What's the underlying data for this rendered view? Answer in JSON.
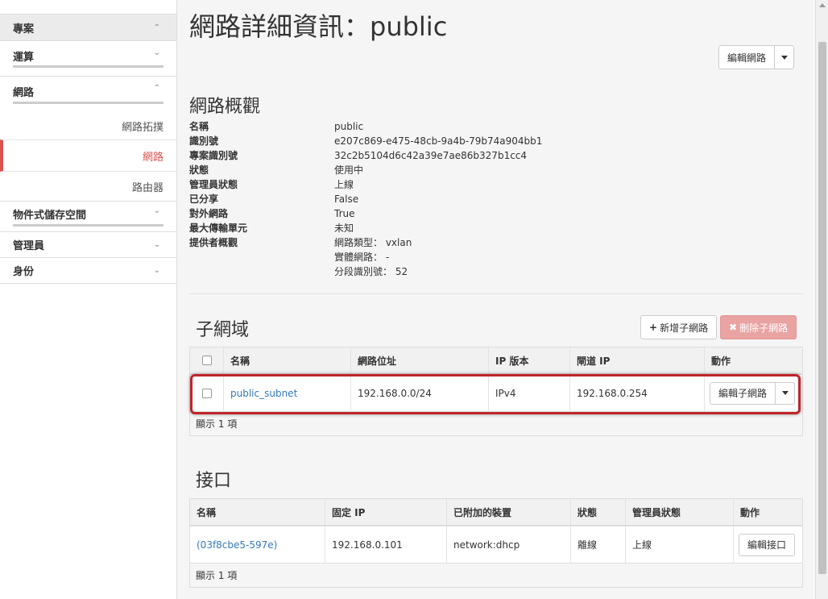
{
  "sidebar": {
    "project": "專案",
    "compute": "運算",
    "network": "網路",
    "network_items": [
      "網路拓撲",
      "網路",
      "路由器"
    ],
    "object_storage": "物件式儲存空間",
    "admin": "管理員",
    "identity": "身份"
  },
  "page": {
    "title": "網路詳細資訊：public",
    "edit_network": "編輯網路"
  },
  "overview": {
    "title": "網路概觀",
    "rows": [
      {
        "label": "名稱",
        "value": "public"
      },
      {
        "label": "識別號",
        "value": "e207c869-e475-48cb-9a4b-79b74a904bb1"
      },
      {
        "label": "專案識別號",
        "value": "32c2b5104d6c42a39e7ae86b327b1cc4"
      },
      {
        "label": "狀態",
        "value": "使用中"
      },
      {
        "label": "管理員狀態",
        "value": "上線"
      },
      {
        "label": "已分享",
        "value": "False"
      },
      {
        "label": "對外網路",
        "value": "True"
      },
      {
        "label": "最大傳輸單元",
        "value": "未知"
      },
      {
        "label": "提供者概觀",
        "value": "網路類型： vxlan"
      },
      {
        "label": "",
        "value": "實體網路： -"
      },
      {
        "label": "",
        "value": "分段識別號： 52"
      }
    ]
  },
  "subnets": {
    "title": "子網域",
    "add_button": "新增子網路",
    "delete_button": "刪除子網路",
    "headers": [
      "名稱",
      "網路位址",
      "IP 版本",
      "閘道 IP",
      "動作"
    ],
    "row": {
      "name": "public_subnet",
      "cidr": "192.168.0.0/24",
      "ip_version": "IPv4",
      "gateway": "192.168.0.254",
      "action": "編輯子網路"
    },
    "footer": "顯示 1 項"
  },
  "ports": {
    "title": "接口",
    "headers": [
      "名稱",
      "固定 IP",
      "已附加的裝置",
      "狀態",
      "管理員狀態",
      "動作"
    ],
    "row": {
      "name": "(03f8cbe5-597e)",
      "fixed_ip": "192.168.0.101",
      "device": "network:dhcp",
      "status": "離線",
      "admin_state": "上線",
      "action": "編輯接口"
    },
    "footer": "顯示 1 項"
  }
}
